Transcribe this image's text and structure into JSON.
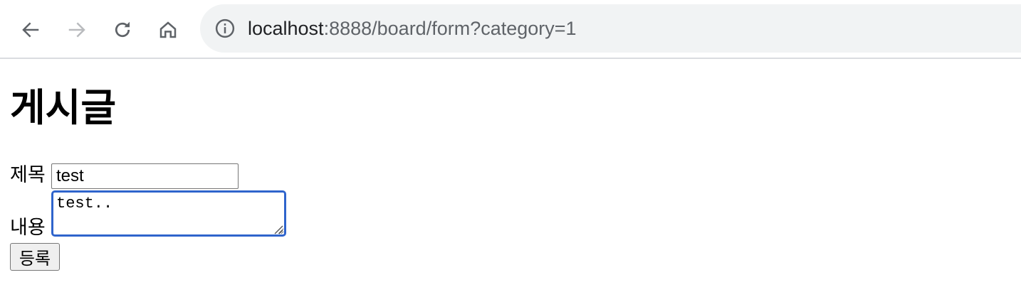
{
  "browser": {
    "url_host": "localhost",
    "url_rest": ":8888/board/form?category=1",
    "icons": [
      "back-arrow-icon",
      "forward-arrow-icon",
      "reload-icon",
      "home-icon",
      "info-icon"
    ],
    "forward_disabled": true
  },
  "page": {
    "title": "게시글",
    "form": {
      "title_label": "제목",
      "title_value": "test",
      "body_label": "내용",
      "body_value": "test..",
      "submit_label": "등록"
    }
  },
  "colors": {
    "focus_ring": "#2f64cc",
    "omnibox_bg": "#f1f3f4",
    "button_bg": "#efefef"
  }
}
